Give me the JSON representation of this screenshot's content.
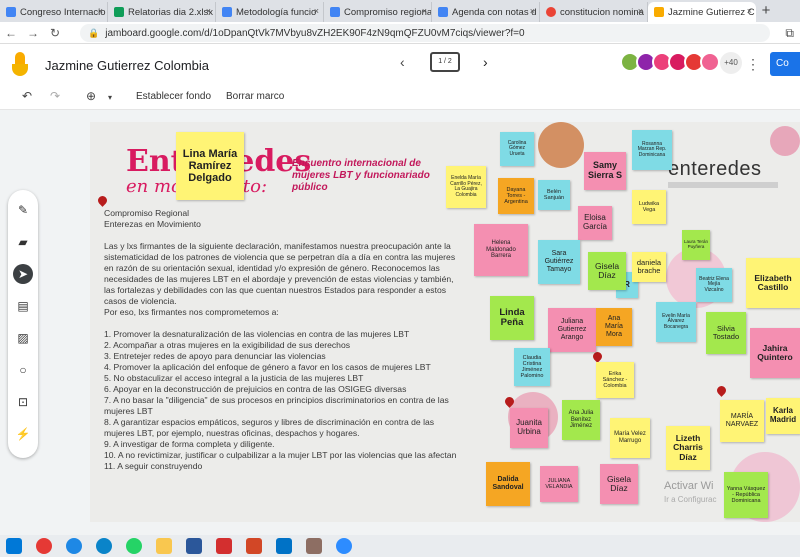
{
  "browser": {
    "tabs": [
      {
        "label": "Congreso Internacio",
        "color": "#4285f4"
      },
      {
        "label": "Relatorias dia 2.xlsx",
        "color": "#0f9d58"
      },
      {
        "label": "Metodología funcio",
        "color": "#4285f4"
      },
      {
        "label": "Compromiso regiona",
        "color": "#4285f4"
      },
      {
        "label": "Agenda con notas d",
        "color": "#4285f4"
      },
      {
        "label": "constitucion nomina",
        "color": "#ea4335"
      },
      {
        "label": "Jazmine Gutierrez C",
        "color": "#f9ab00"
      }
    ],
    "new_tab": "+",
    "close_glyph": "×",
    "url": "jamboard.google.com/d/1oDpanQtVk7MVbyu8vZH2EK90F4zN9qmQFZU0vM7ciqs/viewer?f=0"
  },
  "app": {
    "title": "Jazmine Gutierrez Colombia",
    "frame_counter": "1 / 2",
    "avatar_more": "+40",
    "share_label": "Co"
  },
  "toolbar": {
    "set_background": "Establecer fondo",
    "clear_frame": "Borrar marco"
  },
  "slide": {
    "title_main": "Entreredes",
    "title_sub": "en movimiento:",
    "encuentro": "Encuentro internacional de mujeres LBT y funcionariado público",
    "brand": "enteredes",
    "watermark_1": "Activar Wi",
    "watermark_2": "Ir a Configurac",
    "body": {
      "heading_1": "Compromiso Regional",
      "heading_2": "Enterezas en Movimiento",
      "paragraph": "Las y lxs firmantes de la siguiente declaración, manifestamos nuestra preocupación ante la sistematicidad de los patrones de violencia que se perpetran día a día en contra las mujeres en razón de su orientación sexual, identidad y/o expresión de género. Reconocemos las necesidades de las mujeres LBT en el abordaje y prevención de estas violencias y también, las fortalezas y debilidades con las que cuentan nuestros Estados para responder a estos casos de violencia.",
      "intro": "Por eso, lxs firmantes nos comprometemos a:",
      "items": [
        "1. Promover la desnaturalización de las violencias en contra de las mujeres LBT",
        "2. Acompañar a otras mujeres en la exigibilidad de sus derechos",
        "3. Entretejer redes de apoyo para denunciar las violencias",
        "4. Promover la aplicación del enfoque de género a favor en los casos de mujeres LBT",
        "5. No obstaculizar el acceso integral a la justicia de las mujeres LBT",
        "6. Apoyar en la deconstrucción de prejuicios en contra de las OSIGEG diversas",
        "7. A no basar la \"diligencia\" de sus procesos en principios discriminatorios en contra de las mujeres LBT",
        "8. A garantizar espacios empáticos, seguros y libres de discriminación en contra de las mujeres LBT, por ejemplo, nuestras oficinas, despachos y hogares.",
        "9. A investigar de forma completa y diligente.",
        "10. A no revictimizar, justificar o culpabilizar a la mujer LBT por las violencias que las afectan",
        "11. A seguir construyendo"
      ]
    },
    "notes": {
      "lina": "Lina María Ramírez Delgado",
      "carolina": "Carolina Gómez Urueta",
      "rosanna": "Rosanna Marzan Rep. Dominicana",
      "samy": "Samy Sierra S",
      "enelda": "Enelda María Carrillo Pérez, La Guajira Colombia",
      "dayana": "Dayana Torres - Argentina",
      "belen": "Belén Sanjuán",
      "ludwika": "Ludwika Vega",
      "eloisa": "Eloisa García",
      "helena": "Helena Maldonado Barrera",
      "sara": "Sara Gutiérrez Tamayo",
      "gisela1": "Gisela Díaz",
      "r": "R",
      "daniela": "daniela brache",
      "laura": "Laura Terán Puyñera",
      "beatriz": "Beatriz Elena Mejía Vizcaíno",
      "elizabeth": "Elizabeth Castillo",
      "linda": "Linda Peña",
      "juliana1": "Juliana Gutierrez Arango",
      "ana": "Ana María Mora",
      "evelin": "Evelin María Álvarez Bocanegra",
      "silvia": "Silvia Tostado",
      "jahira": "Jahira Quintero",
      "claudia": "Claudia Cristina Jiménez Palomino",
      "erika": "Erika Sánchez - Colombia",
      "juanita": "Juanita Urbina",
      "anajulia": "Ana Julia Benítez Jiménez",
      "mariavelez": "María Velez Marrugo",
      "lizeth": "Lizeth Charris Díaz",
      "narvaez": "MARÍA NARVAEZ",
      "karla": "Karla Madrid",
      "dalida": "Dalida Sandoval",
      "julianav": "JULIANA VELANDIA",
      "gisela2": "Gisela Díaz",
      "yanna": "Yanna Vásquez - República Dominicana"
    }
  }
}
